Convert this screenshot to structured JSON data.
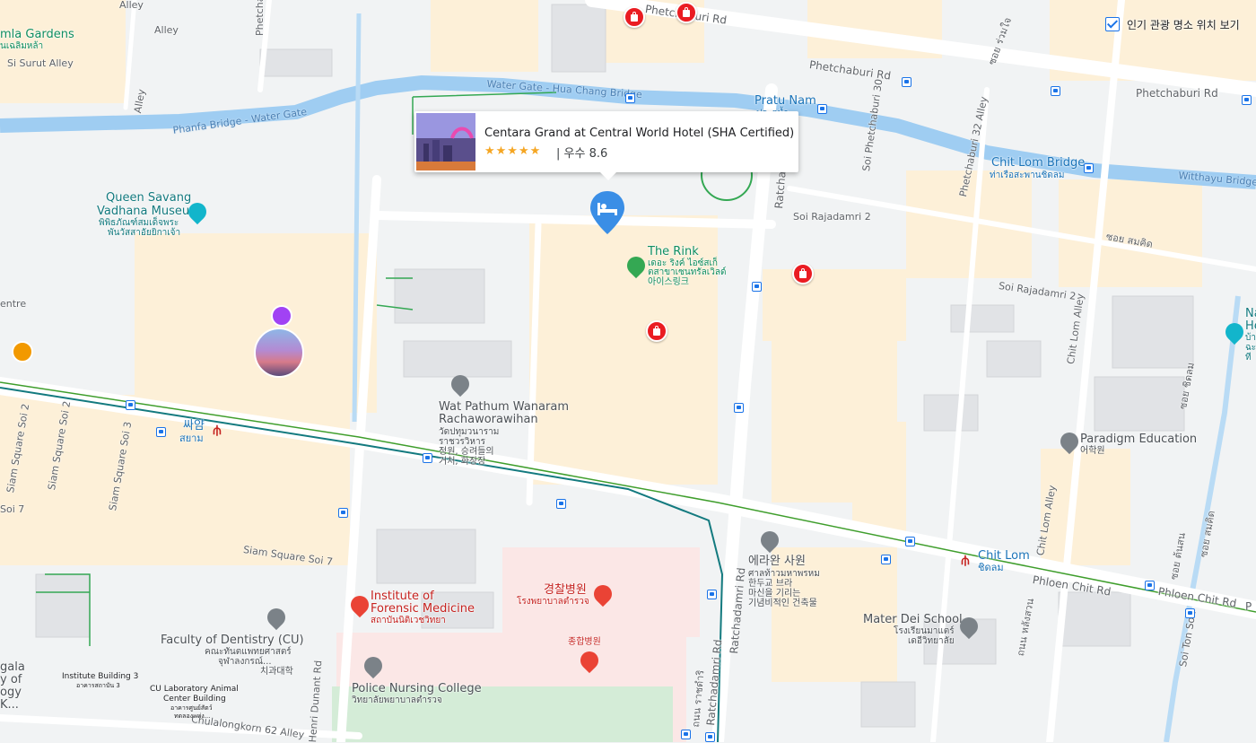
{
  "popup": {
    "title": "Centara Grand at Central World Hotel (SHA Certified)",
    "stars": "★★★★★",
    "rating": "| 우수 8.6"
  },
  "toggle": {
    "label": "인기 관광 명소 위치 보기",
    "checked": true
  },
  "streets": {
    "alley1": "Alley",
    "alley2": "Alley",
    "alley3": "Alley",
    "phetch_top": "Phetchaburi Rd",
    "phetch_mid": "Phetchaburi Rd",
    "phetch_right": "Phetchaburi Rd",
    "si_surut": "Si Surut Alley",
    "phetchab_soi": "Phetchab",
    "soi_phetch30": "Soi Phetchaburi 30",
    "phetch32": "Phetchaburi 32 Alley",
    "ratchad": "Ratchad",
    "soi_rajadamri2a": "Soi Rajadamri 2",
    "soi_rajadamri2b": "Soi Rajadamri 2",
    "chitlom_alley1": "Chit Lom Alley",
    "chitlom_alley2": "Chit Lom Alley",
    "siam_sq_soi2": "Siam Square Soi 2",
    "siam_sq_soi3": "Siam Square Soi 3",
    "siam_sq_soi7": "Siam Square Soi 7",
    "soi7": "Soi 7",
    "ratchadamri_rd1": "Ratchadamri Rd",
    "ratchadamri_rd2": "Ratchadamri Rd",
    "phloen1": "Phloen Chit Rd",
    "phloen2": "Phloen Chit Rd",
    "phloen_p": "P",
    "henri": "Henri Dunant Rd",
    "chula62": "Chulalongkorn 62 Alley",
    "soi_ton_son": "Soi Ton Son",
    "centre": "entre",
    "th_soi1": "ซอย ร่วมใจ",
    "th_soi2": "ซอย สมคิด",
    "th_soi3": "ซอย ชิดลม",
    "th_soi4": "ซอย ต้นสน",
    "th_soi5": "ซอย สมคิด",
    "th_thanon": "ถนน หลังสวน",
    "th_ratch": "ถนน ราชดำริ"
  },
  "water": {
    "watergate": "Water Gate - Hua Chang Bridge",
    "phanfa": "Phanfa Bridge - Water Gate",
    "witthayu": "Witthayu Bridge"
  },
  "places": {
    "kamla": "mla Gardens",
    "kamla_th": "นเฉลิมหล้า",
    "queen1": "Queen Savang",
    "queen2": "Vadhana Museum",
    "queen_th1": "พิพิธภัณฑ์สมเด็จพระ",
    "queen_th2": "พันวัสสาอัยยิกาเจ้า",
    "rink": "The Rink",
    "rink_th1": "เดอะ ริงค์ ไอซ์สเก็",
    "rink_th2": "ตสาขาเซนทรัลเวิลด์",
    "rink_ko": "아이스링크",
    "wat1": "Wat Pathum Wanaram",
    "wat2": "Rachaworawihan",
    "wat_th1": "วัดปทุมวนาราม",
    "wat_th2": "ราชวรวิหาร",
    "wat_ko1": "정원, 승려들의",
    "wat_ko2": "거처, 화장장",
    "pratu": "Pratu Nam",
    "pratu_th": "ประตูน้ำ",
    "chitlom_bridge": "Chit Lom Bridge",
    "chitlom_bridge_th": "ท่าเรือสะพานชิดลม",
    "siam_ko": "싸얌",
    "siam_th": "สยาม",
    "chitlom_st": "Chit Lom",
    "chitlom_st_th": "ชิดลม",
    "paradigm": "Paradigm Education",
    "paradigm_ko": "어학원",
    "erawan_ko": "에라완 사원",
    "erawan_th1": "ศาลท้าวมหาพรหม",
    "erawan_ko2": "한두교 브라",
    "erawan_ko3": "마신을 기리는",
    "erawan_ko4": "기념비적인 건축물",
    "mater": "Mater Dei School",
    "mater_th": "โรงเรียนมาแตร์",
    "mater_th2": "เดอีวิทยาลัย",
    "forensic1": "Institute of",
    "forensic2": "Forensic Medicine",
    "forensic_th": "สถาบันนิติเวชวิทยา",
    "police_hosp_ko": "경찰병원",
    "police_hosp_th": "โรงพยาบาลตำรวจ",
    "general_ko": "종합병원",
    "nursing": "Police Nursing College",
    "nursing_th": "วิทยาลัยพยาบาลตำรวจ",
    "dentistry": "Faculty of Dentistry (CU)",
    "dentistry_th1": "คณะทันตแพทยศาสตร์",
    "dentistry_th2": "จุฬาลงกรณ์...",
    "dentistry_ko": "치과대학",
    "inst3": "Institute Building 3",
    "inst3_th": "อาคารสถาบัน 3",
    "culab1": "CU Laboratory Animal",
    "culab2": "Center Building",
    "culab_th1": "อาคารศูนย์สัตว์",
    "culab_th2": "ทดลองแห่ง...",
    "gala1": "gala",
    "gala2": "y of",
    "gala3": "ogy",
    "gala4": "K...",
    "nai1": "Na",
    "nai2": "He",
    "nai3": "บ้า",
    "nai4": "ฉะ",
    "nai5": "ที"
  }
}
